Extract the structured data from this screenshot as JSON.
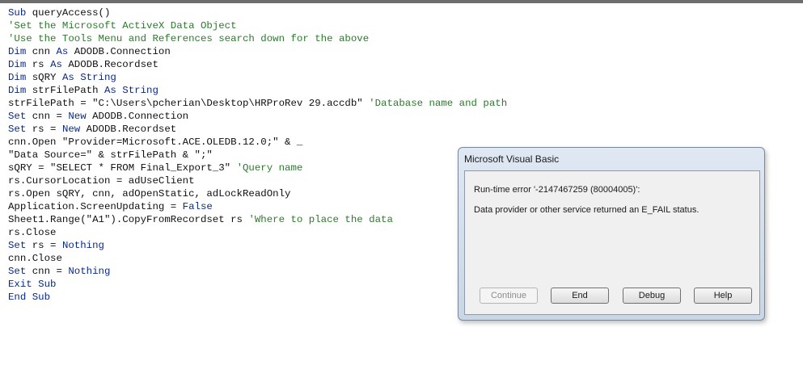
{
  "code": {
    "lines": [
      [
        {
          "c": "kw",
          "t": "Sub"
        },
        {
          "c": "tx",
          "t": " queryAccess()"
        }
      ],
      [
        {
          "c": "cm",
          "t": "'Set the Microsoft ActiveX Data Object"
        }
      ],
      [
        {
          "c": "cm",
          "t": "'Use the Tools Menu and References search down for the above"
        }
      ],
      [
        {
          "c": "kw",
          "t": "Dim"
        },
        {
          "c": "tx",
          "t": " cnn "
        },
        {
          "c": "kw",
          "t": "As"
        },
        {
          "c": "tx",
          "t": " ADODB.Connection"
        }
      ],
      [
        {
          "c": "kw",
          "t": "Dim"
        },
        {
          "c": "tx",
          "t": " rs "
        },
        {
          "c": "kw",
          "t": "As"
        },
        {
          "c": "tx",
          "t": " ADODB.Recordset"
        }
      ],
      [
        {
          "c": "kw",
          "t": "Dim"
        },
        {
          "c": "tx",
          "t": " sQRY "
        },
        {
          "c": "kw",
          "t": "As String"
        }
      ],
      [
        {
          "c": "kw",
          "t": "Dim"
        },
        {
          "c": "tx",
          "t": " strFilePath "
        },
        {
          "c": "kw",
          "t": "As String"
        }
      ],
      [
        {
          "c": "tx",
          "t": "strFilePath = \"C:\\Users\\pcherian\\Desktop\\HRProRev 29.accdb\" "
        },
        {
          "c": "cm",
          "t": "'Database name and path"
        }
      ],
      [
        {
          "c": "kw",
          "t": "Set"
        },
        {
          "c": "tx",
          "t": " cnn = "
        },
        {
          "c": "kw",
          "t": "New"
        },
        {
          "c": "tx",
          "t": " ADODB.Connection"
        }
      ],
      [
        {
          "c": "kw",
          "t": "Set"
        },
        {
          "c": "tx",
          "t": " rs = "
        },
        {
          "c": "kw",
          "t": "New"
        },
        {
          "c": "tx",
          "t": " ADODB.Recordset"
        }
      ],
      [
        {
          "c": "tx",
          "t": "cnn.Open \"Provider=Microsoft.ACE.OLEDB.12.0;\" & _"
        }
      ],
      [
        {
          "c": "tx",
          "t": "\"Data Source=\" & strFilePath & \";\""
        }
      ],
      [
        {
          "c": "tx",
          "t": "sQRY = \"SELECT * FROM Final_Export_3\" "
        },
        {
          "c": "cm",
          "t": "'Query name"
        }
      ],
      [
        {
          "c": "tx",
          "t": "rs.CursorLocation = adUseClient"
        }
      ],
      [
        {
          "c": "tx",
          "t": "rs.Open sQRY, cnn, adOpenStatic, adLockReadOnly"
        }
      ],
      [
        {
          "c": "tx",
          "t": "Application.ScreenUpdating = "
        },
        {
          "c": "kw",
          "t": "False"
        }
      ],
      [
        {
          "c": "tx",
          "t": "Sheet1.Range(\"A1\").CopyFromRecordset rs "
        },
        {
          "c": "cm",
          "t": "'Where to place the data"
        }
      ],
      [
        {
          "c": "tx",
          "t": "rs.Close"
        }
      ],
      [
        {
          "c": "kw",
          "t": "Set"
        },
        {
          "c": "tx",
          "t": " rs = "
        },
        {
          "c": "kw",
          "t": "Nothing"
        }
      ],
      [
        {
          "c": "tx",
          "t": "cnn.Close"
        }
      ],
      [
        {
          "c": "kw",
          "t": "Set"
        },
        {
          "c": "tx",
          "t": " cnn = "
        },
        {
          "c": "kw",
          "t": "Nothing"
        }
      ],
      [
        {
          "c": "kw",
          "t": "Exit Sub"
        }
      ],
      [
        {
          "c": "kw",
          "t": "End Sub"
        }
      ]
    ]
  },
  "dialog": {
    "title": "Microsoft Visual Basic",
    "error_line": "Run-time error '-2147467259 (80004005)':",
    "message": "Data provider or other service returned an E_FAIL status.",
    "buttons": {
      "continue": "Continue",
      "end": "End",
      "debug": "Debug",
      "help": "Help"
    }
  },
  "colors": {
    "keyword": "#0b2a86",
    "comment": "#2b7b2b",
    "text": "#101010"
  }
}
